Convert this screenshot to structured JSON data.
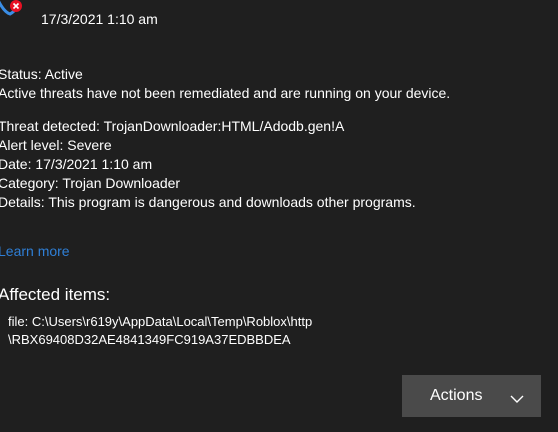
{
  "header": {
    "icon": "threat-shield-error-icon",
    "timestamp": "17/3/2021 1:10 am"
  },
  "status": {
    "status_line": "Status: Active",
    "message": "Active threats have not been remediated and are running on your device."
  },
  "details": {
    "threat": "Threat detected: TrojanDownloader:HTML/Adodb.gen!A",
    "alert_level": "Alert level: Severe",
    "date": "Date: 17/3/2021 1:10 am",
    "category": "Category: Trojan Downloader",
    "description": "Details: This program is dangerous and downloads other programs."
  },
  "learn_more": "Learn more",
  "affected": {
    "heading": "Affected items:",
    "items": [
      "file: C:\\Users\\r619y\\AppData\\Local\\Temp\\Roblox\\http",
      "\\RBX69408D32AE4841349FC919A37EDBBDEA"
    ]
  },
  "actions": {
    "label": "Actions",
    "icon": "chevron-down-icon"
  },
  "colors": {
    "background": "#1f1f1f",
    "link": "#2f7fd6",
    "button": "#4a4a4a",
    "error_badge": "#e81123"
  }
}
